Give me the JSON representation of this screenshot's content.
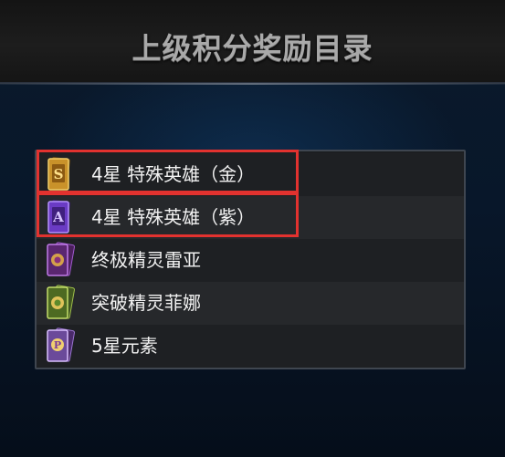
{
  "header": {
    "title": "上级积分奖励目录"
  },
  "items": [
    {
      "label": "4星 特殊英雄（金）",
      "icon": "gold-s-card-icon",
      "highlighted": true
    },
    {
      "label": "4星 特殊英雄（紫）",
      "icon": "purple-a-card-icon",
      "highlighted": true
    },
    {
      "label": "终极精灵雷亚",
      "icon": "purple-spirit-card-icon",
      "highlighted": false
    },
    {
      "label": "突破精灵菲娜",
      "icon": "green-spirit-card-icon",
      "highlighted": false
    },
    {
      "label": "5星元素",
      "icon": "element-card-icon",
      "highlighted": false
    }
  ],
  "colors": {
    "highlight": "#e2322f",
    "title": "#a9a9a9",
    "row_text": "#f2f2f2"
  }
}
